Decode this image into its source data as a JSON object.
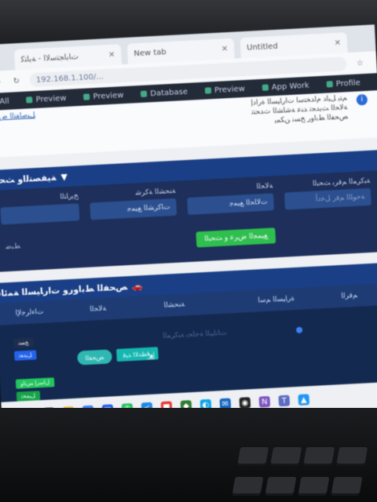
{
  "browser": {
    "tabs": [
      {
        "label": "ﺕﺎﺑﺎﺠﺘﺳﻻﺍ - ﺔﺑﺎﺘﻛ"
      },
      {
        "label": "New tab"
      },
      {
        "label": "Untitled"
      }
    ],
    "url": "192.168.1.100/..."
  },
  "bookmarks": [
    {
      "label": "All"
    },
    {
      "label": "Preview"
    },
    {
      "label": "Preview"
    },
    {
      "label": "Database"
    },
    {
      "label": "Preview"
    },
    {
      "label": "App Work"
    },
    {
      "label": "Profile"
    }
  ],
  "notes": {
    "link": "ﻞﻴﺻﺎﻔﺘﻟﺍ ﺽﺮﻋ",
    "lines": [
      "ﻢﺘﻳ ﻞﻴﻟﺩ ﻡﺍﺪﺨﺘﺳﺍ ﺕﺍﺭﺎﻴﺴﻟﺍ ﺓﺭﺍﺩﺇ",
      "ﺔﻟﺎﺤﻟﺍ ﺚﻳﺪﺤﺗ ﺪﻨﻋ ﺔﺷﺎﺸﻟﺍ ﺙﺪﺤﺘﺗ",
      "ﺺﺤﻔﻟﺍ ﻂﺑﺍﻭﺭ ﺦﺴﻧ ﻦﻜﻤﻳ"
    ]
  },
  "filter": {
    "title": "ﺔﻴﻔﺼﺘﻟﺍﻭ ﺚﺤﺒﻟﺍ",
    "search_label": "ﺔﺒﻛﺮﻤﻟﺍ ﻢﻗﺮﺑ ﺚﺤﺒﻟﺍ",
    "search_placeholder": "ﺔﺣﻮﻠﻟﺍ ﻢﻗﺭ ﻞﺧﺩﺃ",
    "status_label": "ﺔﻟﺎﺤﻟﺍ",
    "status_value": "ﺕﻻﺎﺤﻟﺍ ﻊﻴﻤﺟ",
    "company_label": "ﺔﻨﺤﺸﻟﺍ ﺔﻛﺮﺷ",
    "company_value": "ﺕﺎﻛﺮﺸﻟﺍ ﻊﻴﻤﺟ",
    "date_label": "ﺦﻳﺭﺎﺘﻟﺍ",
    "show_button": "ﻊﻴﻤﺠﻟﺍ ﺽﺮﻋ ﻭ ﺚﺤﺒﻟﺍ",
    "reset": "ﻂﺒﺿ"
  },
  "list": {
    "title": "ﺺﺤﻔﻟﺍ ﻂﺑﺍﻭﺭﻭ ﺕﺍﺭﺎﻴﺴﻟﺍ ﺔﻤﺋﺎﻗ",
    "columns": [
      "ﻢﻗﺮﻟﺍ",
      "ﺓﺭﺎﻴﺴﻟﺍ ﻢﺳﺍ",
      "ﺔﻨﺤﺸﻟﺍ",
      "ﺔﻟﺎﺤﻟﺍ",
      "ﺕﺍﺀﺍﺮﺟﻹﺍ"
    ],
    "row": {
      "dim_text": "ﺕﺎﻧﺎﻴﺒﻟﺍ ﺔﺟﺎﺤﺑ ﺔﺒﻛﺮﻤﻟﺍ",
      "status_button": "ﺭﺎﻈﺘﻧﻻﺍ ﺪﻴﻗ",
      "status_pill": "ﺺﺤﻔﻟﺍ",
      "actions": [
        "ﺦﺴﻧ",
        "ﻞﻳﺪﻌﺗ",
        "ﻝﺎﺳﺭﺇ ﺲﺗﺍﻭ",
        "ﻞﻴﻤﺤﺗ"
      ]
    }
  },
  "colors": {
    "accent": "#1a3f86",
    "success": "#2fbf4f",
    "teal": "#16b7b0"
  },
  "taskbar": {
    "icons": [
      "search-icon",
      "taskview-icon",
      "explorer-icon",
      "chrome-icon",
      "store-icon",
      "whatsapp-icon",
      "vscode-icon",
      "office-icon",
      "photos-icon",
      "edge-icon",
      "mail-icon",
      "camera-icon",
      "onenote-icon",
      "teams-icon",
      "app-icon"
    ]
  }
}
